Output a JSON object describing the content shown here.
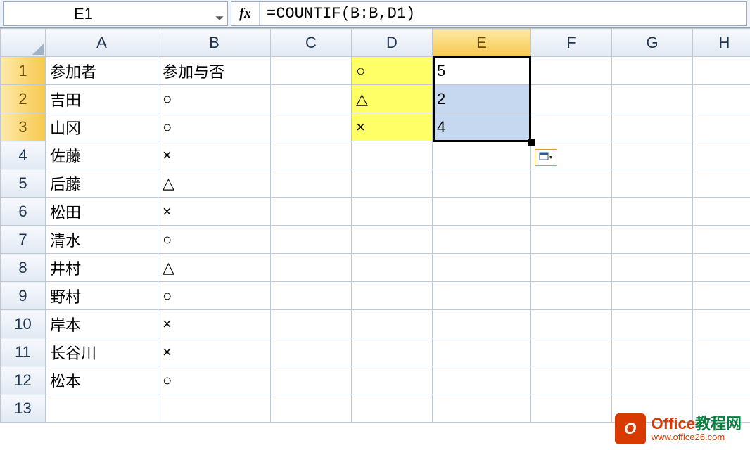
{
  "namebox": {
    "cellRef": "E1"
  },
  "formulaBar": {
    "fxLabel": "fx",
    "formula": "=COUNTIF(B:B,D1)"
  },
  "columns": [
    "A",
    "B",
    "C",
    "D",
    "E",
    "F",
    "G",
    "H"
  ],
  "rows": [
    "1",
    "2",
    "3",
    "4",
    "5",
    "6",
    "7",
    "8",
    "9",
    "10",
    "11",
    "12",
    "13"
  ],
  "activeCol": "E",
  "activeRows": [
    "1",
    "2",
    "3"
  ],
  "cells": {
    "A1": "参加者",
    "B1": "参加与否",
    "D1": "○",
    "E1": "5",
    "A2": "吉田",
    "B2": "○",
    "D2": "△",
    "E2": "2",
    "A3": "山冈",
    "B3": "○",
    "D3": "×",
    "E3": "4",
    "A4": "佐藤",
    "B4": "×",
    "A5": "后藤",
    "B5": "△",
    "A6": "松田",
    "B6": "×",
    "A7": "清水",
    "B7": "○",
    "A8": "井村",
    "B8": "△",
    "A9": "野村",
    "B9": "○",
    "A10": "岸本",
    "B10": "×",
    "A11": "长谷川",
    "B11": "×",
    "A12": "松本",
    "B12": "○"
  },
  "watermark": {
    "title": "Office教程网",
    "url": "www.office26.com"
  },
  "chart_data": {
    "type": "table",
    "columns": [
      "参加者",
      "参加与否"
    ],
    "rows": [
      [
        "吉田",
        "○"
      ],
      [
        "山冈",
        "○"
      ],
      [
        "佐藤",
        "×"
      ],
      [
        "后藤",
        "△"
      ],
      [
        "松田",
        "×"
      ],
      [
        "清水",
        "○"
      ],
      [
        "井村",
        "△"
      ],
      [
        "野村",
        "○"
      ],
      [
        "岸本",
        "×"
      ],
      [
        "长谷川",
        "×"
      ],
      [
        "松本",
        "○"
      ]
    ],
    "summary": {
      "○": 5,
      "△": 2,
      "×": 4
    }
  }
}
